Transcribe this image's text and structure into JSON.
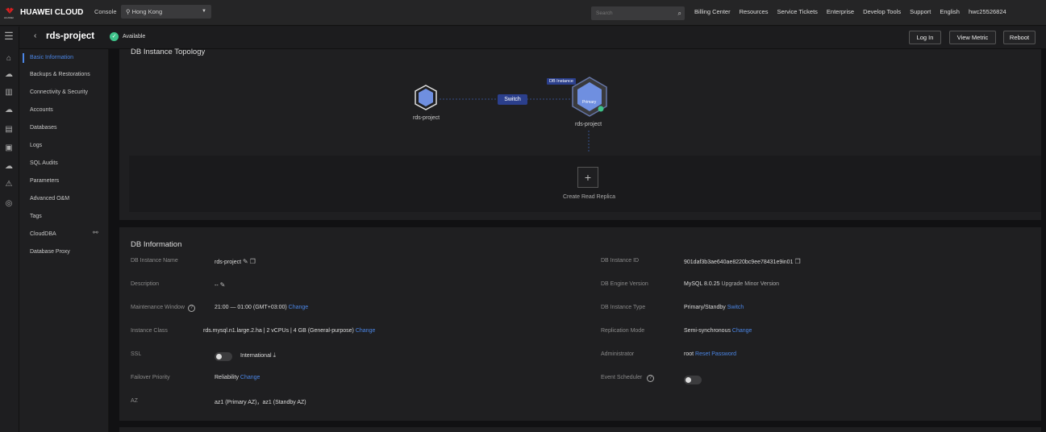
{
  "topbar": {
    "brand": "HUAWEI CLOUD",
    "console": "Console",
    "region": "Hong Kong",
    "search_placeholder": "Search",
    "nav": [
      "Billing Center",
      "Resources",
      "Service Tickets",
      "Enterprise",
      "Develop Tools",
      "Support",
      "English",
      "hwc25526824"
    ]
  },
  "header": {
    "title": "rds-project",
    "status": "Available",
    "buttons": {
      "login": "Log In",
      "view_metric": "View Metric",
      "reboot": "Reboot"
    }
  },
  "sidebar": {
    "items": [
      {
        "label": "Basic Information"
      },
      {
        "label": "Backups & Restorations"
      },
      {
        "label": "Connectivity & Security"
      },
      {
        "label": "Accounts"
      },
      {
        "label": "Databases"
      },
      {
        "label": "Logs"
      },
      {
        "label": "SQL Audits"
      },
      {
        "label": "Parameters"
      },
      {
        "label": "Advanced O&M"
      },
      {
        "label": "Tags"
      },
      {
        "label": "CloudDBA"
      },
      {
        "label": "Database Proxy"
      }
    ]
  },
  "topology": {
    "title": "DB Instance Topology",
    "standby_label": "rds-project",
    "primary_label": "rds-project",
    "primary_role": "Primary",
    "switch": "Switch",
    "db_instance_tag": "DB Instance",
    "create_replica": "Create Read Replica"
  },
  "info": {
    "title": "DB Information",
    "rows_left": [
      {
        "label": "DB Instance Name",
        "value": "rds-project"
      },
      {
        "label": "Description",
        "value": "--"
      },
      {
        "label": "Maintenance Window",
        "value": "21:00 — 01:00 (GMT+03:00)",
        "action": "Change"
      },
      {
        "label": "Instance Class",
        "value": "rds.mysql.n1.large.2.ha | 2 vCPUs | 4 GB (General-purpose)",
        "action": "Change"
      },
      {
        "label": "SSL",
        "value": "International"
      },
      {
        "label": "Failover Priority",
        "value": "Reliability",
        "action": "Change"
      },
      {
        "label": "AZ",
        "value": "az1 (Primary AZ)，az1 (Standby AZ)"
      }
    ],
    "rows_right": [
      {
        "label": "DB Instance ID",
        "value": "901daf3b3ae640ae8220bc9ee78431e9in01"
      },
      {
        "label": "DB Engine Version",
        "value": "MySQL 8.0.25",
        "action": "Upgrade Minor Version"
      },
      {
        "label": "DB Instance Type",
        "value": "Primary/Standby",
        "action": "Switch"
      },
      {
        "label": "Replication Mode",
        "value": "Semi-synchronous",
        "action": "Change"
      },
      {
        "label": "Administrator",
        "value": "root",
        "action": "Reset Password"
      },
      {
        "label": "Event Scheduler",
        "value": ""
      }
    ]
  },
  "colors": {
    "accent": "#4b86e6",
    "available": "#3ec38a",
    "switch_bg": "#2b3f8c"
  }
}
